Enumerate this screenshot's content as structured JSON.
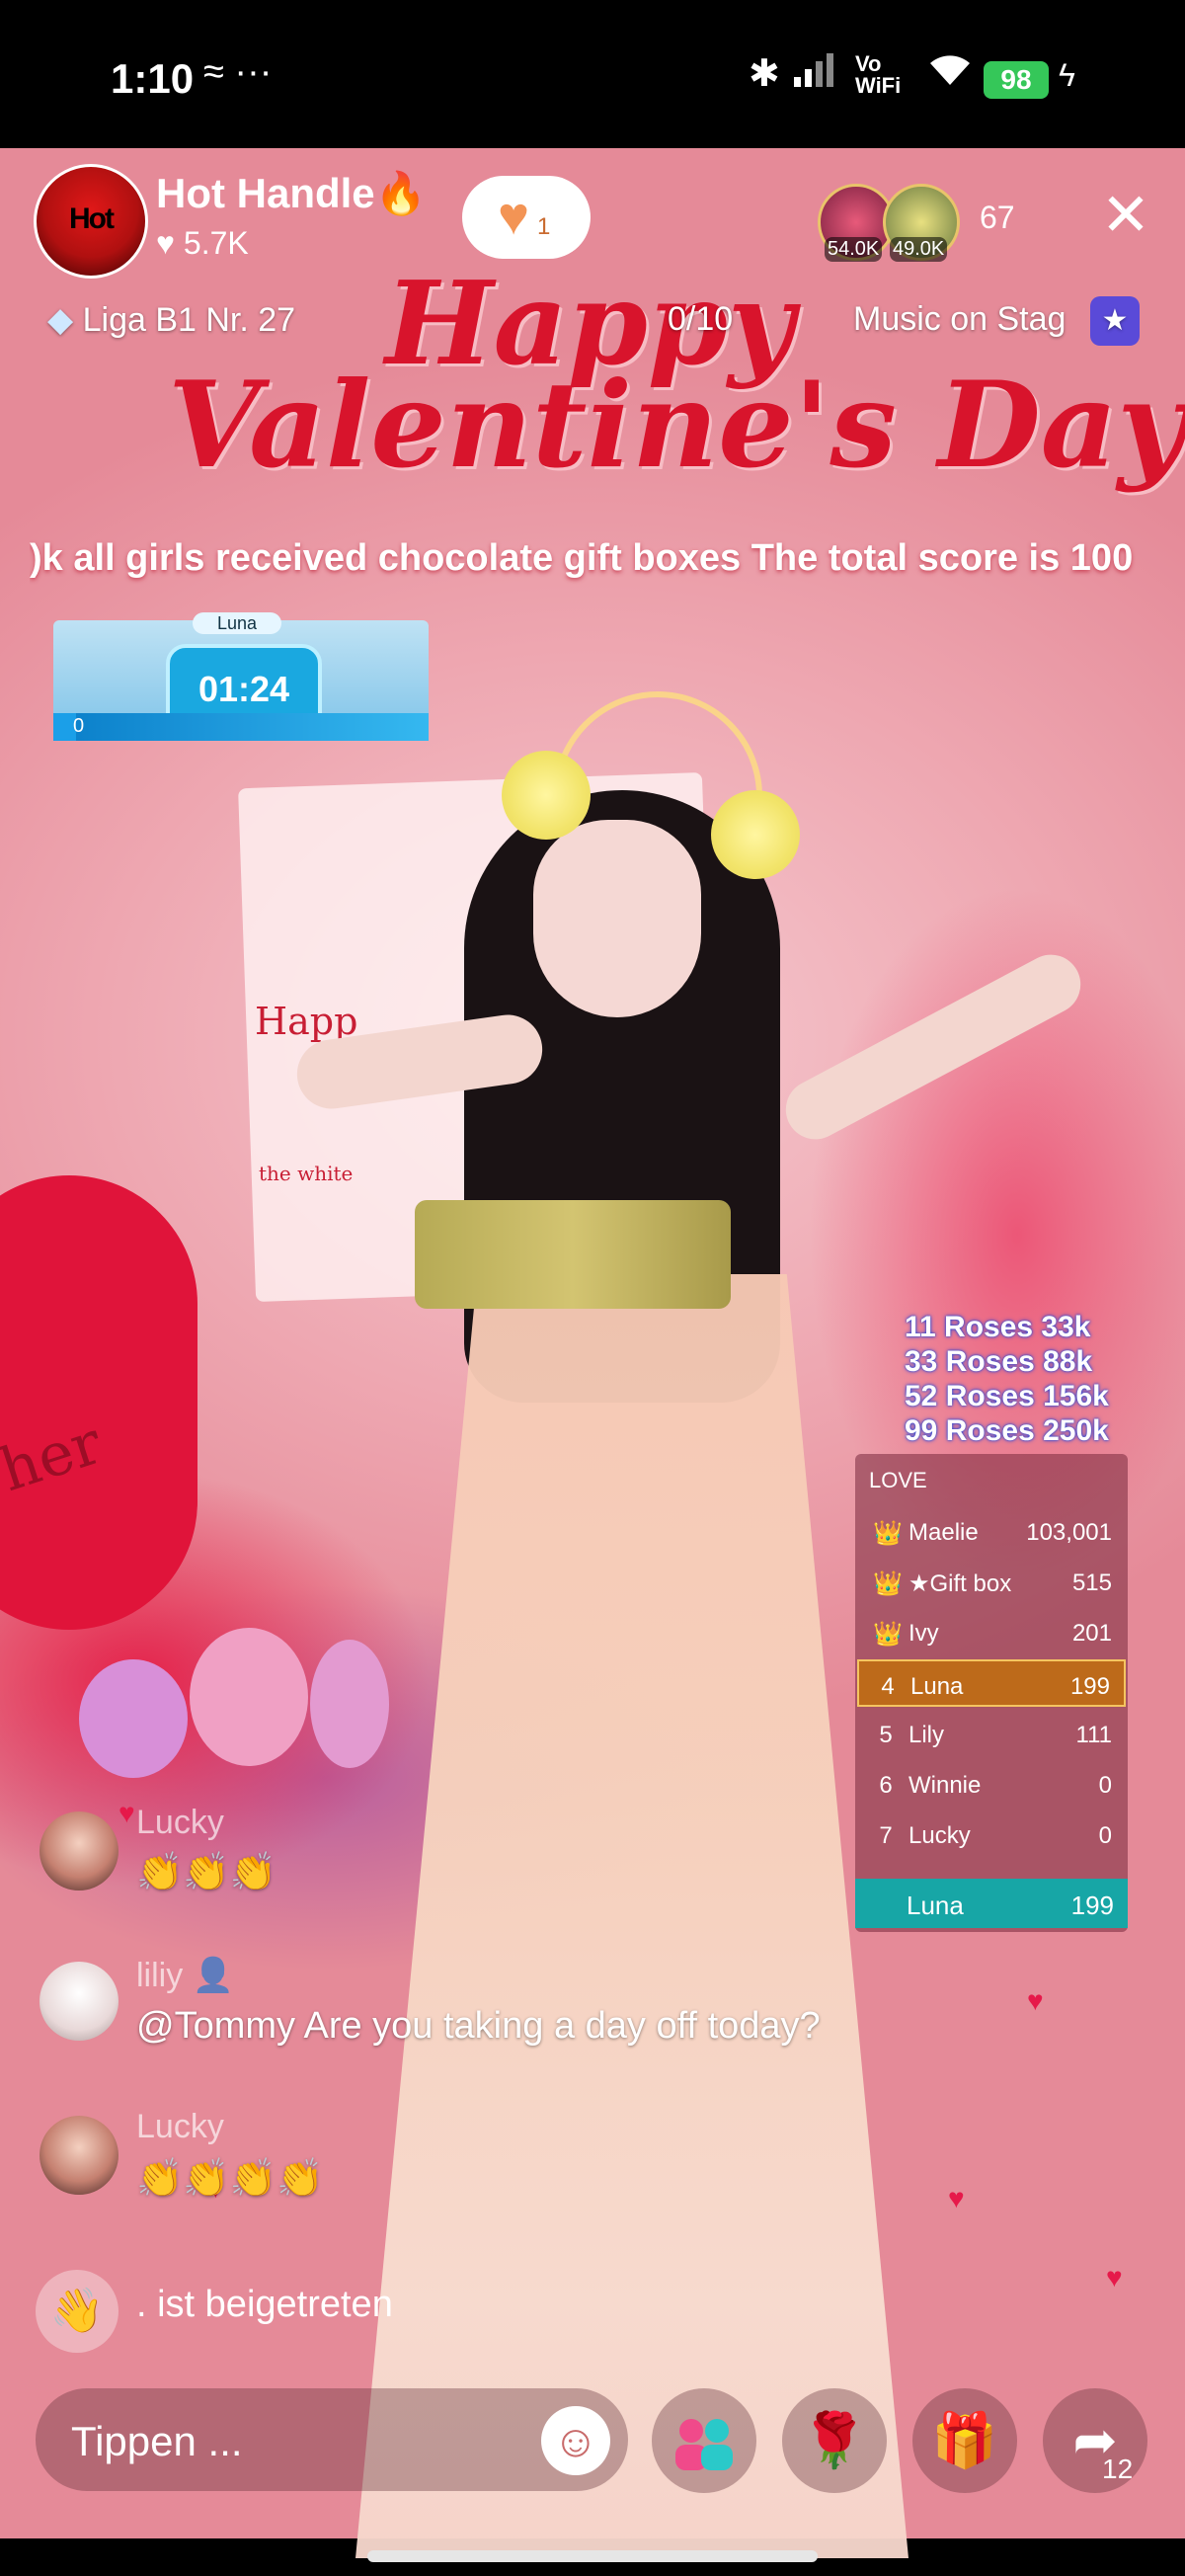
{
  "status_bar": {
    "time": "1:10",
    "notif_icons": "≈ ···",
    "signal": "Vo WiFi",
    "battery": "98"
  },
  "live": {
    "host_name": "Hot Handle🔥",
    "host_avatar_text": "Hot",
    "host_likes": "♥ 5.7K",
    "follow_heart_count": "1",
    "top_viewers": [
      {
        "tag": "54.0K"
      },
      {
        "tag": "49.0K"
      }
    ],
    "viewer_count": "67",
    "league": "Liga B1 Nr. 27",
    "goal": "0/10",
    "music": "Music on Stag"
  },
  "stream": {
    "title_line1": "Happy",
    "title_line2": "Valentine's Day",
    "panel_line1": "Happ",
    "panel_line2": "the white",
    "panel_word": "her",
    "ticker": ")k all girls received chocolate gift boxes     The total score is 100",
    "timer": {
      "name": "Luna",
      "time": "01:24",
      "score": "0",
      "progress": 0.06
    },
    "rose_tiers": [
      "11 Roses 33k",
      "33 Roses 88k",
      "52 Roses 156k",
      "99 Roses 250k"
    ]
  },
  "leaderboard": {
    "title": "LOVE",
    "rows": [
      {
        "rank": "👑",
        "name": "Maelie",
        "score": "103,001",
        "highlight": false
      },
      {
        "rank": "👑",
        "name": "★Gift box",
        "score": "515",
        "highlight": false
      },
      {
        "rank": "👑",
        "name": "Ivy",
        "score": "201",
        "highlight": false
      },
      {
        "rank": "4",
        "name": "Luna",
        "score": "199",
        "highlight": true
      },
      {
        "rank": "5",
        "name": "Lily",
        "score": "111",
        "highlight": false
      },
      {
        "rank": "6",
        "name": "Winnie",
        "score": "0",
        "highlight": false
      },
      {
        "rank": "7",
        "name": "Lucky",
        "score": "0",
        "highlight": false
      }
    ],
    "me": {
      "name": "Luna",
      "score": "199"
    }
  },
  "chat": [
    {
      "user": "Lucky",
      "message": "👏👏👏"
    },
    {
      "user": "liliy 👤",
      "message": "@Tommy Are you taking a day off today?"
    },
    {
      "user": "Lucky",
      "message": "👏👏👏👏"
    }
  ],
  "join_message": ". ist beigetreten",
  "bottom_bar": {
    "comment_placeholder": "Tippen ...",
    "share_count": "12"
  },
  "icons": {
    "bluetooth": "bluetooth-icon",
    "wifi": "wifi-icon",
    "close": "close-icon",
    "diamond": "diamond-icon",
    "heart": "heart-icon",
    "emoji": "emoji-icon",
    "guests": "guests-icon",
    "rose": "rose-icon",
    "gift": "gift-icon",
    "share": "share-icon"
  },
  "colors": {
    "accent_red": "#d8142c",
    "battery_green": "#35c759",
    "leaderboard_highlight": "#bd6a1a",
    "leaderboard_me": "#17a6a6",
    "rose_tier_glow": "#2a48d8"
  }
}
